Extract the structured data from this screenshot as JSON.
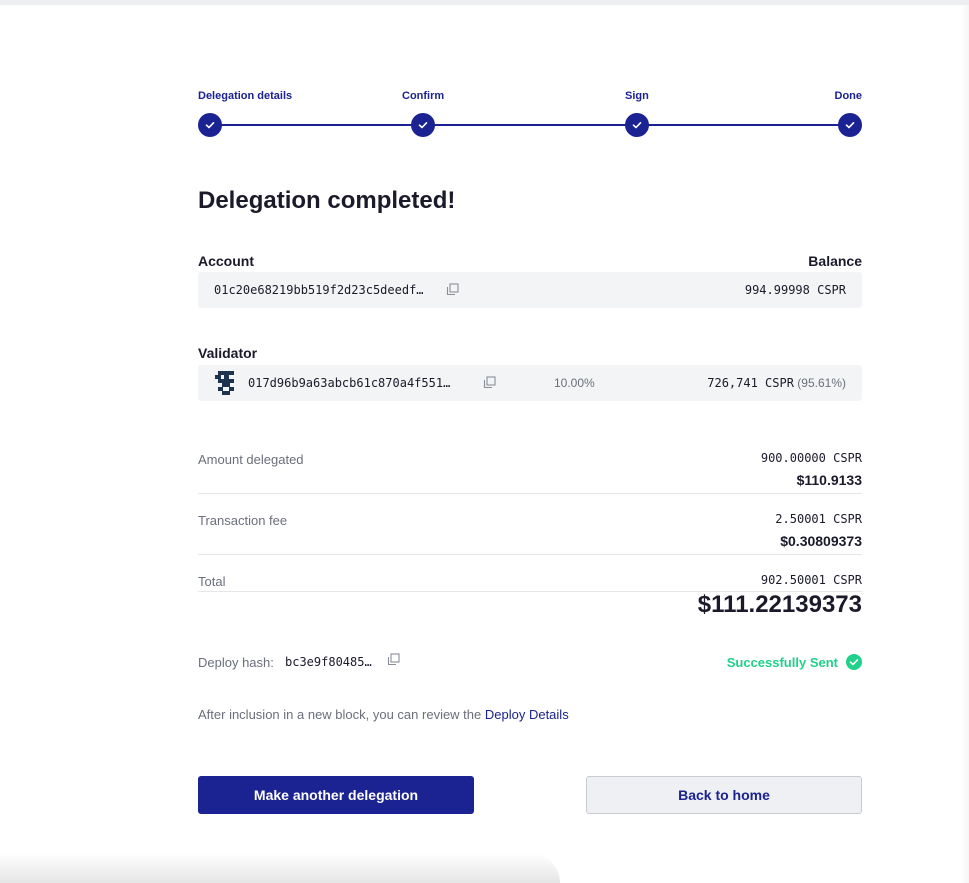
{
  "stepper": {
    "steps": [
      {
        "label": "Delegation details"
      },
      {
        "label": "Confirm"
      },
      {
        "label": "Sign"
      },
      {
        "label": "Done"
      }
    ]
  },
  "page_title": "Delegation completed!",
  "account": {
    "label": "Account",
    "balance_label": "Balance",
    "address": "01c20e68219bb519f2d23c5deedf…",
    "balance": "994.99998 CSPR"
  },
  "validator": {
    "label": "Validator",
    "address": "017d96b9a63abcb61c870a4f551…",
    "fee": "10.00%",
    "stake": "726,741 CSPR",
    "stake_share": "(95.61%)"
  },
  "summary": {
    "amount": {
      "label": "Amount delegated",
      "cspr": "900.00000 CSPR",
      "usd": "$110.9133"
    },
    "fee": {
      "label": "Transaction fee",
      "cspr": "2.50001 CSPR",
      "usd": "$0.30809373"
    },
    "total": {
      "label": "Total",
      "cspr": "902.50001 CSPR",
      "usd": "$111.22139373"
    }
  },
  "deploy": {
    "label": "Deploy hash:",
    "hash": "bc3e9f80485…",
    "status": "Successfully Sent"
  },
  "info": {
    "text": "After inclusion in a new block, you can review the ",
    "link": "Deploy Details"
  },
  "buttons": {
    "primary": "Make another delegation",
    "secondary": "Back to home"
  },
  "colors": {
    "accent": "#1b2291",
    "success": "#1fd18a",
    "muted": "#6b6f7b"
  }
}
